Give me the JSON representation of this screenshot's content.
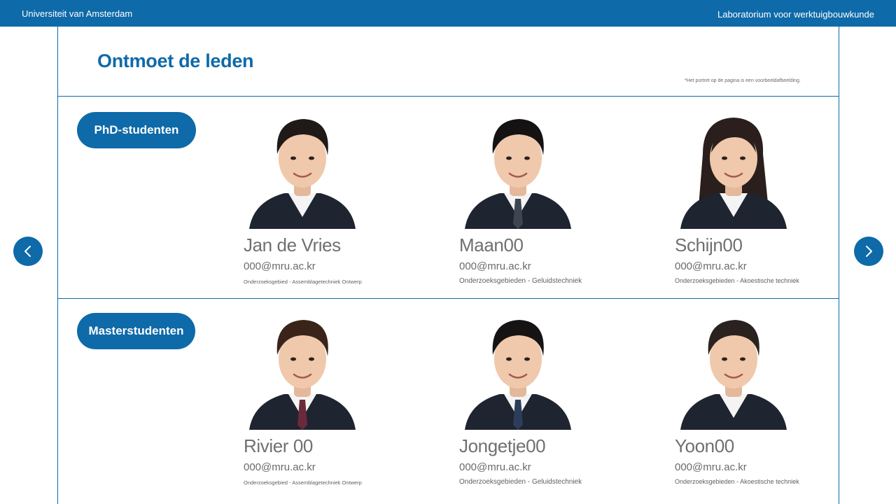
{
  "header": {
    "university": "Universiteit van Amsterdam",
    "lab": "Laboratorium voor werktuigbouwkunde"
  },
  "page": {
    "title": "Ontmoet de leden",
    "note": "*Het portret op de pagina is een voorbeeldafbeelding."
  },
  "sections": [
    {
      "label": "PhD-studenten",
      "members": [
        {
          "name": "Jan de Vries",
          "email": "000@mru.ac.kr",
          "area": "Onderzoeksgebied - Assemblagetechniek Ontwerp",
          "hair": "#1f1a18",
          "tie": "none"
        },
        {
          "name": "Maan00",
          "email": "000@mru.ac.kr",
          "area": "Onderzoeksgebieden - Geluidstechniek",
          "hair": "#141212",
          "tie": "#3c4550"
        },
        {
          "name": "Schijn00",
          "email": "000@mru.ac.kr",
          "area": "Onderzoeksgebieden - Akoestische techniek",
          "hair": "#2a1f1c",
          "tie": "none"
        }
      ]
    },
    {
      "label": "Masterstudenten",
      "members": [
        {
          "name": "Rivier 00",
          "email": "000@mru.ac.kr",
          "area": "Onderzoeksgebied - Assemblagetechniek Ontwerp",
          "hair": "#3a2419",
          "tie": "#6b2a3c"
        },
        {
          "name": "Jongetje00",
          "email": "000@mru.ac.kr",
          "area": "Onderzoeksgebieden - Geluidstechniek",
          "hair": "#151313",
          "tie": "#2c3d5c"
        },
        {
          "name": "Yoon00",
          "email": "000@mru.ac.kr",
          "area": "Onderzoeksgebieden - Akoestische techniek",
          "hair": "#2a221f",
          "tie": "none"
        }
      ]
    }
  ],
  "nav": {
    "prev_icon": "chevron-left-icon",
    "next_icon": "chevron-right-icon"
  },
  "colors": {
    "brand": "#0e6aa8",
    "text_gray": "#707070"
  }
}
